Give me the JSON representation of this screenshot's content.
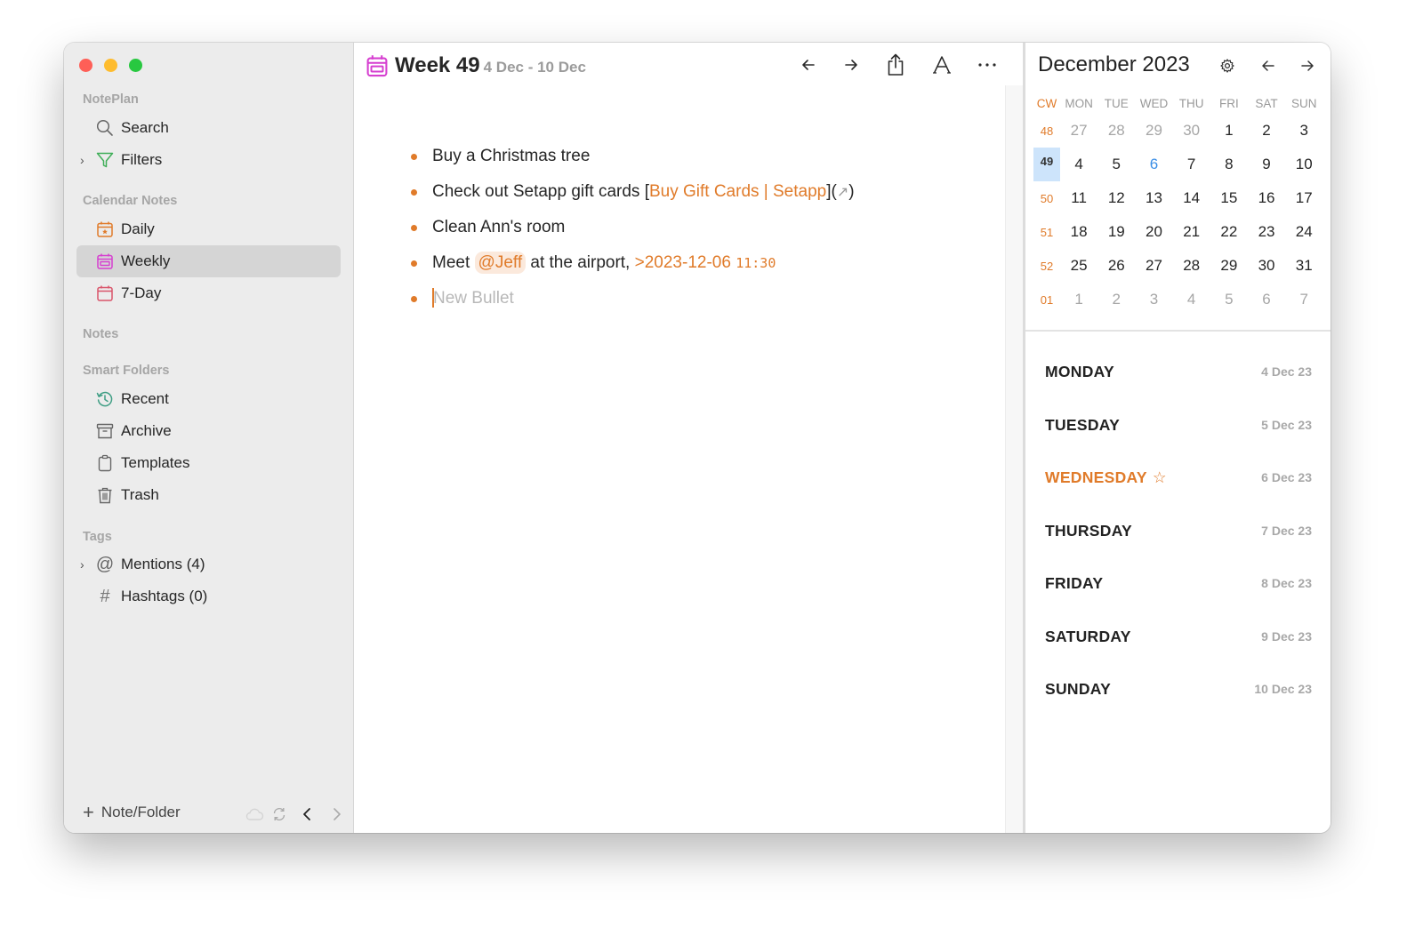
{
  "window": {
    "traffic_lights": [
      "close",
      "minimize",
      "zoom"
    ]
  },
  "sidebar": {
    "sections": {
      "noteplan": "NotePlan",
      "calendar_notes": "Calendar Notes",
      "notes": "Notes",
      "smart_folders": "Smart Folders",
      "tags": "Tags"
    },
    "items": {
      "search": {
        "label": "Search",
        "icon": "search-icon"
      },
      "filters": {
        "label": "Filters",
        "icon": "filter-icon",
        "expandable": true
      },
      "daily": {
        "label": "Daily",
        "icon": "calendar-day-icon"
      },
      "weekly": {
        "label": "Weekly",
        "icon": "calendar-week-icon",
        "active": true
      },
      "seven_day": {
        "label": "7-Day",
        "icon": "calendar-icon"
      },
      "recent": {
        "label": "Recent",
        "icon": "history-icon"
      },
      "archive": {
        "label": "Archive",
        "icon": "archive-icon"
      },
      "templates": {
        "label": "Templates",
        "icon": "clipboard-icon"
      },
      "trash": {
        "label": "Trash",
        "icon": "trash-icon"
      },
      "mentions": {
        "label": "Mentions (4)",
        "icon": "at-icon",
        "expandable": true
      },
      "hashtags": {
        "label": "Hashtags (0)",
        "icon": "hash-icon"
      }
    },
    "footer": {
      "add_label": "Note/Folder"
    }
  },
  "editor": {
    "title": "Week 49",
    "subtitle": "4 Dec - 10 Dec",
    "toolbar": [
      "back-arrow",
      "forward-arrow",
      "share",
      "font",
      "more"
    ],
    "bullets": [
      {
        "text": "Buy a Christmas tree"
      },
      {
        "prefix": "Check out Setapp gift cards [",
        "link": "Buy Gift Cards | Setapp",
        "suffix_open": "](",
        "link_arrow": "↗",
        "suffix_close": ")"
      },
      {
        "text": "Clean Ann's room"
      },
      {
        "prefix": "Meet ",
        "mention": "@Jeff",
        "middle": " at the airport, ",
        "date": ">2023-12-06",
        "time": "11:30"
      },
      {
        "placeholder": "New Bullet"
      }
    ]
  },
  "calendar": {
    "title": "December 2023",
    "headers": [
      "CW",
      "MON",
      "TUE",
      "WED",
      "THU",
      "FRI",
      "SAT",
      "SUN"
    ],
    "weeks": [
      {
        "cw": "48",
        "days": [
          "27",
          "28",
          "29",
          "30",
          "1",
          "2",
          "3"
        ],
        "muted": [
          0,
          1,
          2,
          3
        ]
      },
      {
        "cw": "49",
        "days": [
          "4",
          "5",
          "6",
          "7",
          "8",
          "9",
          "10"
        ],
        "selected": true,
        "today_index": 2
      },
      {
        "cw": "50",
        "days": [
          "11",
          "12",
          "13",
          "14",
          "15",
          "16",
          "17"
        ]
      },
      {
        "cw": "51",
        "days": [
          "18",
          "19",
          "20",
          "21",
          "22",
          "23",
          "24"
        ]
      },
      {
        "cw": "52",
        "days": [
          "25",
          "26",
          "27",
          "28",
          "29",
          "30",
          "31"
        ]
      },
      {
        "cw": "01",
        "days": [
          "1",
          "2",
          "3",
          "4",
          "5",
          "6",
          "7"
        ],
        "muted": [
          0,
          1,
          2,
          3,
          4,
          5,
          6
        ]
      }
    ],
    "week_days": [
      {
        "name": "MONDAY",
        "date": "4 Dec 23"
      },
      {
        "name": "TUESDAY",
        "date": "5 Dec 23"
      },
      {
        "name": "WEDNESDAY",
        "date": "6 Dec 23",
        "today": true,
        "star": "☆"
      },
      {
        "name": "THURSDAY",
        "date": "7 Dec 23"
      },
      {
        "name": "FRIDAY",
        "date": "8 Dec 23"
      },
      {
        "name": "SATURDAY",
        "date": "9 Dec 23"
      },
      {
        "name": "SUNDAY",
        "date": "10 Dec 23"
      }
    ]
  },
  "colors": {
    "accent": "#e07b2a",
    "weekly_icon": "#d63fd0",
    "today_blue": "#3a8ee6",
    "selected_week_bg": "#cde4fb"
  }
}
